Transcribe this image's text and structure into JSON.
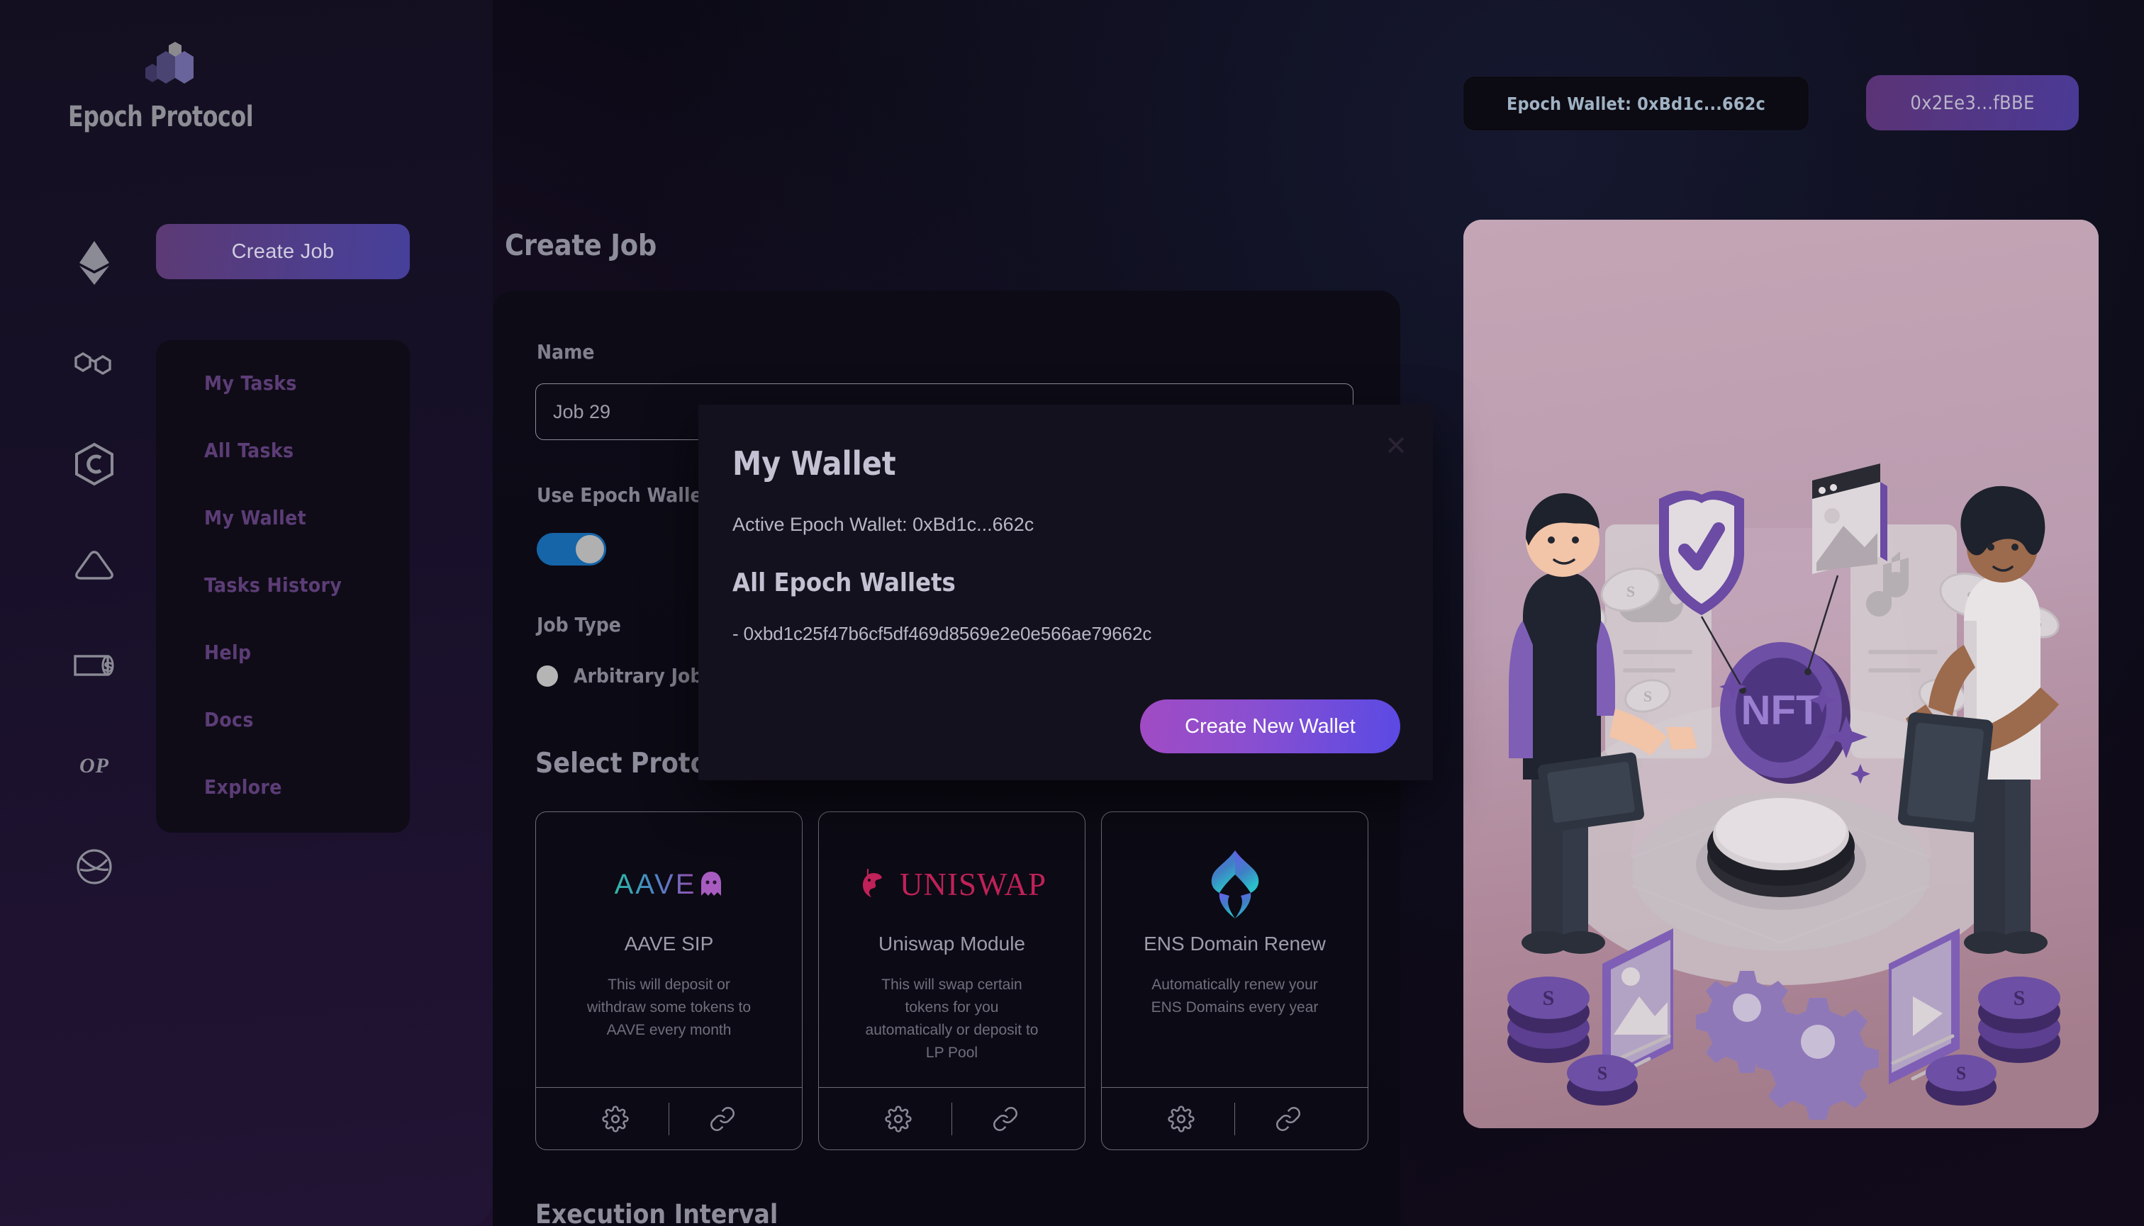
{
  "brand": {
    "name": "Epoch Protocol",
    "logo_icon": "epoch-hexagon-logo"
  },
  "header": {
    "epoch_wallet_pill": "Epoch Wallet: 0xBd1c...662c",
    "account_pill": "0x2Ee3...fBBE"
  },
  "chain_rail": [
    {
      "name": "ethereum",
      "icon": "ethereum-icon"
    },
    {
      "name": "polygon",
      "icon": "polygon-icon"
    },
    {
      "name": "celo",
      "icon": "celo-icon"
    },
    {
      "name": "avalanche",
      "icon": "avalanche-icon"
    },
    {
      "name": "scroll",
      "icon": "scroll-icon"
    },
    {
      "name": "optimism",
      "icon": "optimism-icon",
      "label": "OP"
    },
    {
      "name": "gnosis",
      "icon": "gnosis-icon"
    }
  ],
  "sidebar": {
    "create_job_label": "Create Job",
    "items": [
      {
        "label": "My Tasks"
      },
      {
        "label": "All Tasks"
      },
      {
        "label": "My Wallet"
      },
      {
        "label": "Tasks History"
      },
      {
        "label": "Help"
      },
      {
        "label": "Docs"
      },
      {
        "label": "Explore"
      }
    ]
  },
  "main": {
    "page_title": "Create Job",
    "name_label": "Name",
    "name_value": "Job 29",
    "name_placeholder": "Job 29",
    "use_epoch_wallet_label": "Use Epoch Wallet",
    "use_epoch_wallet_on": true,
    "job_type_label": "Job Type",
    "job_type_option": "Arbitrary Job",
    "select_protocol_title": "Select Protocol",
    "execution_interval_title": "Execution Interval",
    "protocols": [
      {
        "logo": "aave-logo",
        "name": "AAVE SIP",
        "description": "This will deposit or withdraw some tokens to AAVE every month",
        "settings_icon": "gear-icon",
        "link_icon": "link-icon"
      },
      {
        "logo": "uniswap-logo",
        "logo_text": "UNISWAP",
        "name": "Uniswap Module",
        "description": "This will swap certain tokens for you automatically or deposit to LP Pool",
        "settings_icon": "gear-icon",
        "link_icon": "link-icon"
      },
      {
        "logo": "ens-logo",
        "name": "ENS Domain Renew",
        "description": "Automatically renew your ENS Domains every year",
        "settings_icon": "gear-icon",
        "link_icon": "link-icon"
      }
    ]
  },
  "modal": {
    "title": "My Wallet",
    "close_label": "✕",
    "active_wallet_line": "Active Epoch Wallet: 0xBd1c...662c",
    "all_wallets_title": "All Epoch Wallets",
    "wallet_list": [
      "- 0xbd1c25f47b6cf5df469d8569e2e0e566ae79662c"
    ],
    "cta_label": "Create New Wallet"
  },
  "illustration": {
    "alt": "nft-marketplace-illustration"
  },
  "colors": {
    "accent_purple": "#8a4fd0",
    "accent_indigo": "#5a4ae4",
    "toggle_on": "#1565a8",
    "nav_text": "#5c3d76",
    "uniswap_pink": "#bf2158",
    "card_border": "#6c6a78"
  }
}
